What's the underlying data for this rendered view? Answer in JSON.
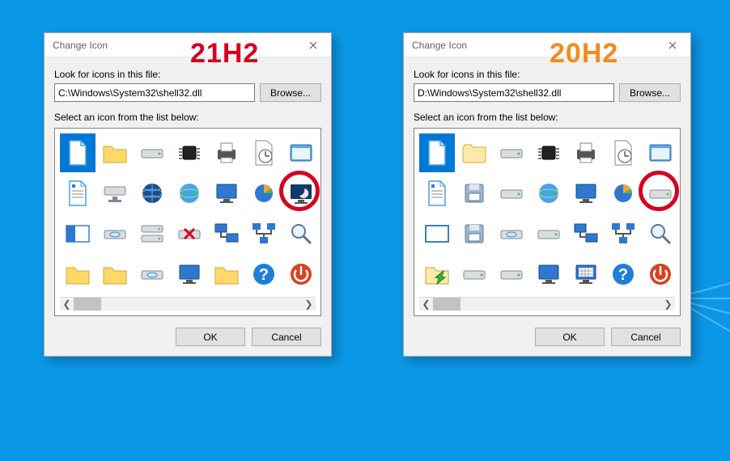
{
  "versions": [
    {
      "label": "21H2",
      "color": "#d7001f"
    },
    {
      "label": "20H2",
      "color": "#f28b1c"
    }
  ],
  "dialogs": [
    {
      "title": "Change Icon",
      "lookfor_label": "Look for icons in this file:",
      "path": "C:\\Windows\\System32\\shell32.dll",
      "browse_label": "Browse...",
      "selectlist_label": "Select an icon from the list below:",
      "ok_label": "OK",
      "cancel_label": "Cancel",
      "selected_index": 0,
      "circled_index": 13,
      "icons": [
        "blank-file",
        "folder",
        "hard-drive",
        "chip",
        "printer",
        "clock-file",
        "window-frame",
        "text-file",
        "network-drive",
        "globe-dark",
        "globe",
        "desktop-monitor",
        "pie-chart",
        "moon-monitor",
        "two-pane",
        "optical-drive",
        "network-services",
        "x-drive",
        "computer-network",
        "network",
        "magnifier",
        "green-folder-arrow",
        "manila-folder",
        "disc-drive",
        "screen",
        "grid-folder",
        "question-blue",
        "power-red"
      ]
    },
    {
      "title": "Change Icon",
      "lookfor_label": "Look for icons in this file:",
      "path": "D:\\Windows\\System32\\shell32.dll",
      "browse_label": "Browse...",
      "selectlist_label": "Select an icon from the list below:",
      "ok_label": "OK",
      "cancel_label": "Cancel",
      "selected_index": 0,
      "circled_index": 13,
      "icons": [
        "blank-file-xp",
        "folder-xp",
        "drive-xp",
        "chip-xp",
        "printer-xp",
        "clock-file-xp",
        "window-frame-xp",
        "text-file-xp",
        "floppy-stack-xp",
        "cd-drive-xp",
        "globe-xp",
        "monitor-xp",
        "pie-chart-xp",
        "moon-drive-xp",
        "window-blank-xp",
        "floppy-xp",
        "cd-stack-xp",
        "x-drive-xp",
        "computer-network-xp",
        "network-xp",
        "magnifier-xp",
        "green-arrow-xp",
        "drive-stack-xp",
        "drive2-xp",
        "screen-xp",
        "monitor-grid-xp",
        "question-blue-xp",
        "power-red-xp"
      ]
    }
  ]
}
